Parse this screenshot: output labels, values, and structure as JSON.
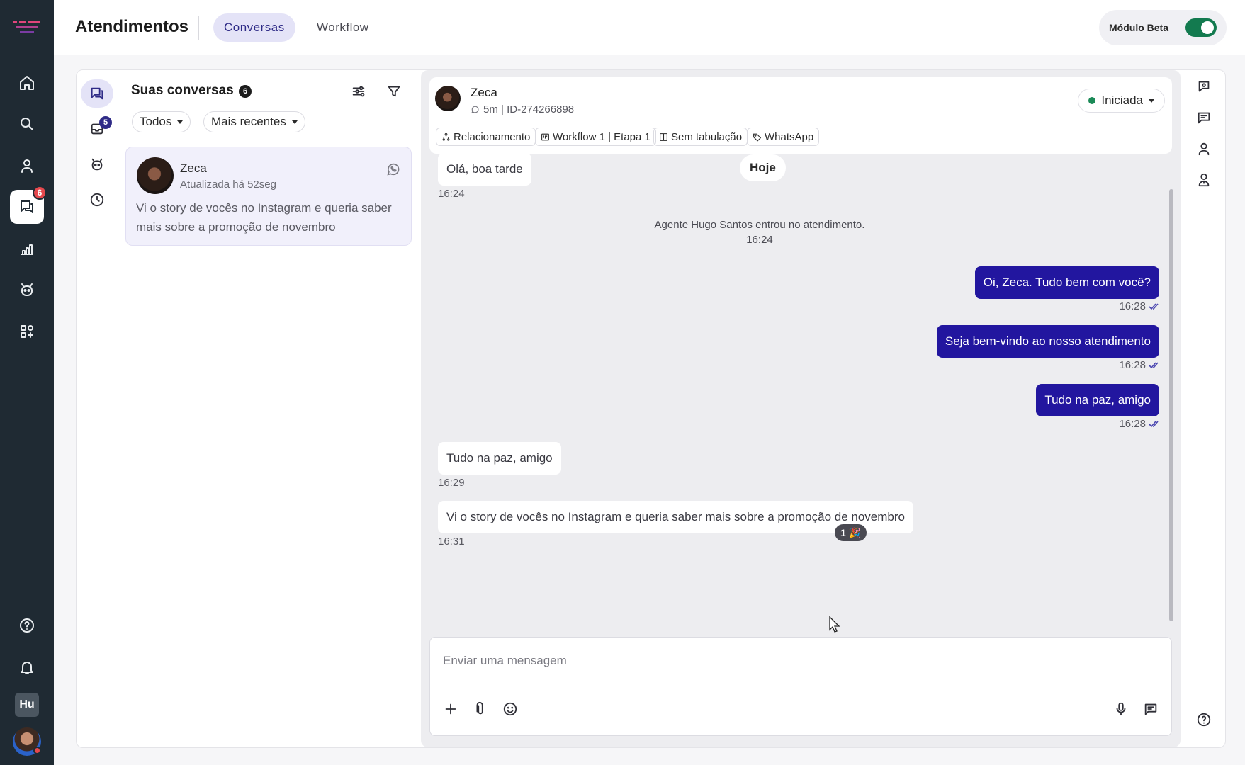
{
  "header": {
    "title": "Atendimentos",
    "tabs": [
      {
        "label": "Conversas",
        "active": true
      },
      {
        "label": "Workflow",
        "active": false
      }
    ],
    "beta_label": "Módulo Beta",
    "beta_enabled": true
  },
  "nav": {
    "items": [
      {
        "icon": "home-icon"
      },
      {
        "icon": "search-icon"
      },
      {
        "icon": "user-icon"
      },
      {
        "icon": "chat-icon",
        "badge": "6",
        "active": true
      },
      {
        "icon": "chart-icon"
      },
      {
        "icon": "bot-icon"
      },
      {
        "icon": "apps-icon"
      }
    ],
    "bottom": [
      {
        "icon": "help-icon"
      },
      {
        "icon": "bell-icon"
      }
    ],
    "workspace_initials": "Hu"
  },
  "secondary_nav": {
    "inbox_badge": "5"
  },
  "conversation_list": {
    "title": "Suas conversas",
    "count": "6",
    "filter_chips": [
      {
        "label": "Todos"
      },
      {
        "label": "Mais recentes"
      }
    ],
    "items": [
      {
        "name": "Zeca",
        "updated": "Atualizada há 52seg",
        "preview": "Vi o story de vocês no Instagram e queria saber mais sobre a promoção de novembro",
        "channel_icon": "whatsapp-icon"
      }
    ]
  },
  "chat": {
    "contact_name": "Zeca",
    "contact_meta": "5m | ID-274266898",
    "status": "Iniciada",
    "status_color": "#1b8a57",
    "tags": [
      {
        "label": "Relacionamento",
        "icon": "org-icon"
      },
      {
        "label": "Workflow 1 | Etapa 1",
        "icon": "board-icon"
      },
      {
        "label": "Sem tabulação",
        "icon": "grid-icon"
      },
      {
        "label": "WhatsApp",
        "icon": "tag-icon"
      }
    ],
    "day_label": "Hoje",
    "system_event": {
      "text": "Agente Hugo Santos entrou no atendimento.",
      "time": "16:24"
    },
    "messages": [
      {
        "direction": "in",
        "text": "Olá, boa tarde",
        "time": "16:24"
      },
      {
        "direction": "out",
        "text": "Oi, Zeca. Tudo bem com você?",
        "time": "16:28"
      },
      {
        "direction": "out",
        "text": "Seja bem-vindo ao nosso atendimento",
        "time": "16:28"
      },
      {
        "direction": "out",
        "text": "Tudo na paz, amigo",
        "time": "16:28"
      },
      {
        "direction": "in",
        "text": "Tudo na paz, amigo",
        "time": "16:29"
      },
      {
        "direction": "in",
        "text": "Vi o story de vocês no Instagram e queria saber mais sobre a promoção de novembro",
        "time": "16:31",
        "reaction": "1 🎉"
      }
    ],
    "composer_placeholder": "Enviar uma mensagem"
  },
  "colors": {
    "accent": "#22169f",
    "nav_bg": "#1f2a33",
    "active_pill": "#e4e3f7"
  }
}
